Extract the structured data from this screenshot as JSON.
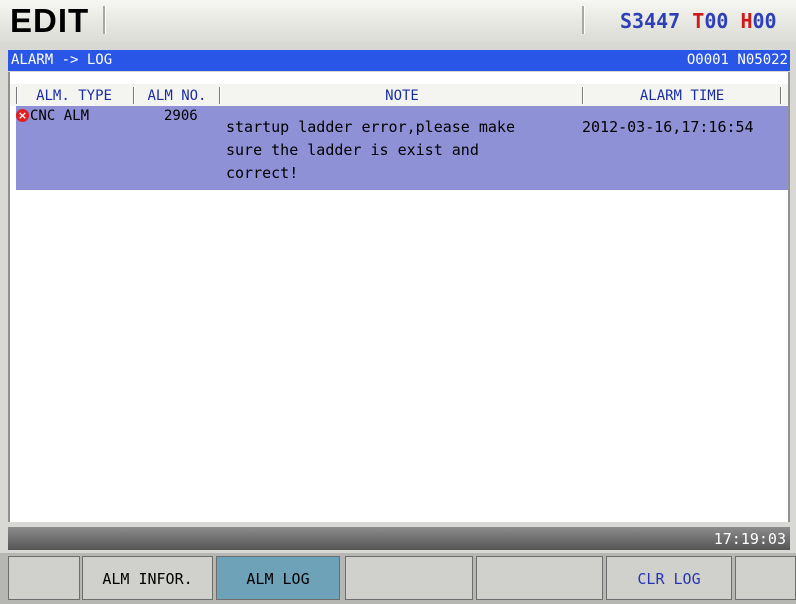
{
  "header": {
    "mode": "EDIT",
    "spindle": "S3447",
    "tool": "T00",
    "offset": "H00"
  },
  "title_bar": {
    "path": "ALARM -> LOG",
    "program": "O0001 N05022"
  },
  "table": {
    "columns": [
      "ALM. TYPE",
      "ALM NO.",
      "NOTE",
      "ALARM TIME"
    ],
    "rows": [
      {
        "type": "CNC ALM",
        "number": "2906",
        "note": [
          "startup ladder error,please make",
          "sure the ladder is exist and",
          "correct!"
        ],
        "time": "2012-03-16,17:16:54",
        "icon": "error-icon"
      }
    ]
  },
  "status": {
    "clock": "17:19:03"
  },
  "softkeys": [
    "",
    "ALM INFOR.",
    "ALM LOG",
    "",
    "",
    "CLR LOG",
    ""
  ],
  "colors": {
    "title_bar": "#2a56e8",
    "selected_row": "#8f91d6",
    "active_key": "#6ea2b8",
    "header_spindle": "#2f3fb8",
    "header_tool_marker": "#d01a1a"
  }
}
